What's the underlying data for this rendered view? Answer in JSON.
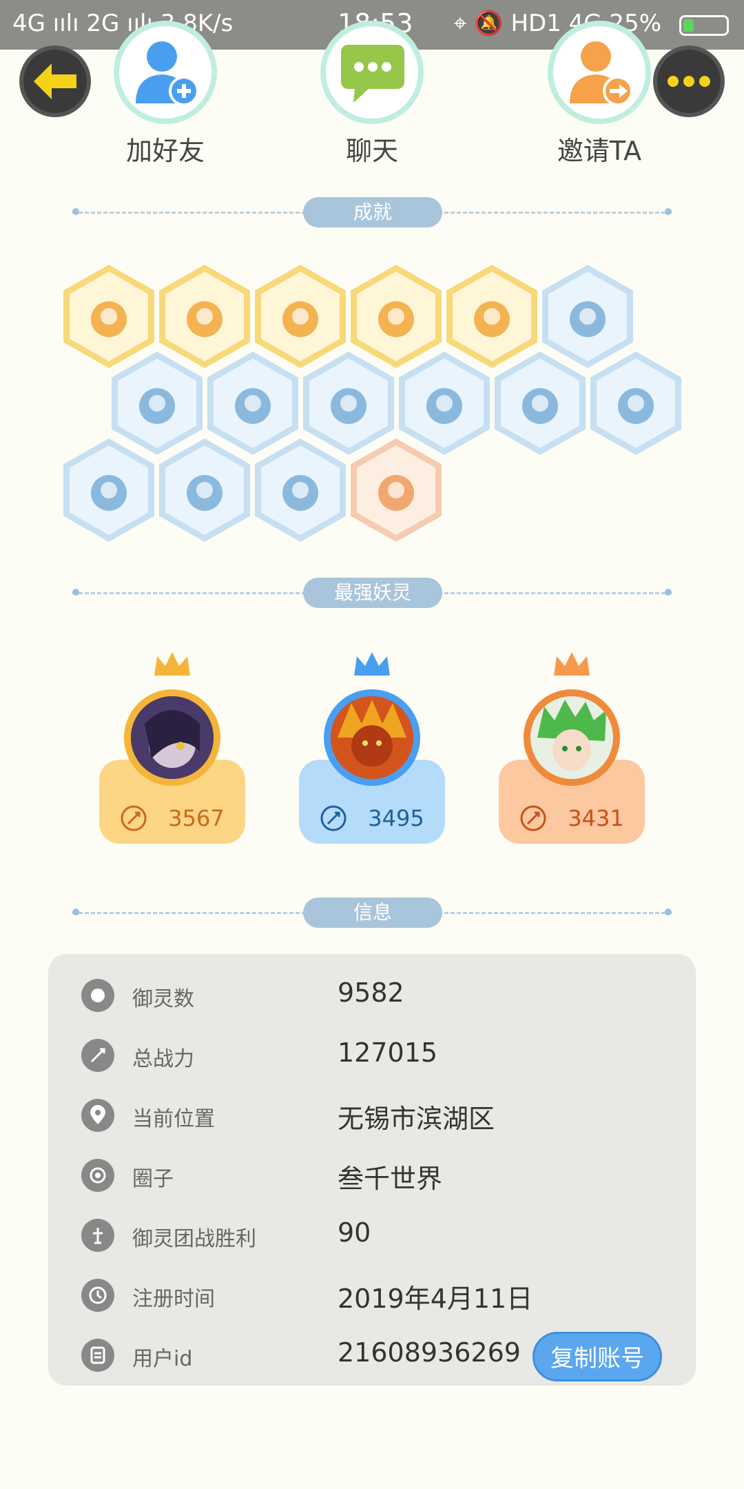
{
  "status_bar": {
    "network_left": "4G ıılı 2G ıılı 3.8K/s",
    "time": "18:53",
    "right": "HD1 4G 25%",
    "battery_percent": 25
  },
  "actions": {
    "add_friend": "加好友",
    "chat": "聊天",
    "invite": "邀请TA"
  },
  "sections": {
    "achievements": "成就",
    "strongest": "最强妖灵",
    "info": "信息"
  },
  "badges_rows": [
    [
      {
        "name": "fox-mask-badge",
        "tier": "gold"
      },
      {
        "name": "gold-orb-badge",
        "tier": "gold"
      },
      {
        "name": "cat-cart-badge",
        "tier": "gold"
      },
      {
        "name": "cat-balloon-badge",
        "tier": "gold"
      },
      {
        "name": "yin-yang-badge",
        "tier": "gold"
      },
      {
        "name": "sneaker-badge",
        "tier": "blue"
      }
    ],
    [
      {
        "name": "portal-staff-badge",
        "tier": "blue"
      },
      {
        "name": "moon-orb-badge",
        "tier": "blue"
      },
      {
        "name": "crystal-badge",
        "tier": "blue"
      },
      {
        "name": "yin-yang-wave-badge",
        "tier": "blue"
      },
      {
        "name": "warrior-badge",
        "tier": "blue"
      },
      {
        "name": "dragon-fish-badge",
        "tier": "blue"
      }
    ],
    [
      {
        "name": "portal-shield-badge",
        "tier": "blue"
      },
      {
        "name": "spirit-pair-badge",
        "tier": "blue"
      },
      {
        "name": "book-fox-badge",
        "tier": "blue"
      },
      {
        "name": "ox-spirit-badge",
        "tier": "orange"
      }
    ]
  ],
  "spirits": [
    {
      "score": "3567",
      "theme": "gold"
    },
    {
      "score": "3495",
      "theme": "blue"
    },
    {
      "score": "3431",
      "theme": "orange"
    }
  ],
  "info": [
    {
      "label": "御灵数",
      "value": "9582",
      "icon": "spirit-icon"
    },
    {
      "label": "总战力",
      "value": "127015",
      "icon": "sword-icon"
    },
    {
      "label": "当前位置",
      "value": "无锡市滨湖区",
      "icon": "location-icon"
    },
    {
      "label": "圈子",
      "value": "叁千世界",
      "icon": "circle-icon"
    },
    {
      "label": "御灵团战胜利",
      "value": "90",
      "icon": "trophy-icon"
    },
    {
      "label": "注册时间",
      "value": "2019年4月11日",
      "icon": "clock-icon"
    },
    {
      "label": "用户id",
      "value": "21608936269",
      "icon": "id-card-icon"
    }
  ],
  "copy_button": "复制账号",
  "colors": {
    "gold": "#fcd585",
    "blue": "#b4dcfa",
    "orange": "#fbc8a0",
    "accent": "#5aa7ef"
  }
}
